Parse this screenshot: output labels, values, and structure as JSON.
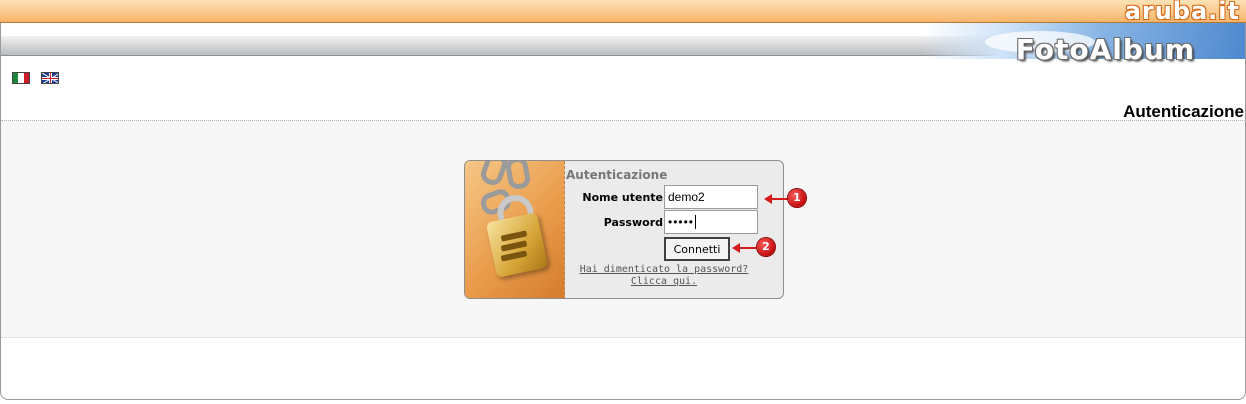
{
  "brand": {
    "aruba_logo": "aruba.it",
    "app_logo": "FotoAlbum"
  },
  "languages": [
    {
      "name": "Italiano",
      "icon": "italy-flag-icon"
    },
    {
      "name": "English",
      "icon": "uk-flag-icon"
    }
  ],
  "page": {
    "section_title": "Autenticazione"
  },
  "login": {
    "box_title": "Autenticazione",
    "username_label": "Nome utente",
    "username_value": "demo2",
    "password_label": "Password",
    "password_value": "•••••",
    "submit_label": "Connetti",
    "forgot_line1": "Hai dimenticato la password?",
    "forgot_line2": "Clicca qui."
  },
  "annotations": [
    {
      "number": "1",
      "target": "username-field"
    },
    {
      "number": "2",
      "target": "connetti-button"
    }
  ],
  "colors": {
    "topbar": "#f7b46a",
    "annotation": "#d41a1a",
    "content_bg": "#f7f7f7"
  }
}
